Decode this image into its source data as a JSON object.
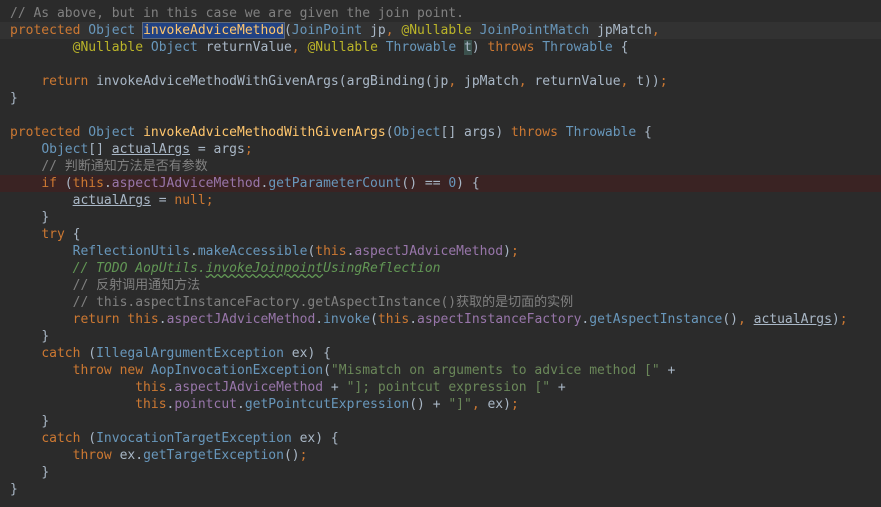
{
  "code_lines": [
    "// As above, but in this case we are given the join point.",
    "protected Object invokeAdviceMethod(JoinPoint jp, @Nullable JoinPointMatch jpMatch,",
    "        @Nullable Object returnValue, @Nullable Throwable t) throws Throwable {",
    "",
    "    return invokeAdviceMethodWithGivenArgs(argBinding(jp, jpMatch, returnValue, t));",
    "}",
    "",
    "protected Object invokeAdviceMethodWithGivenArgs(Object[] args) throws Throwable {",
    "    Object[] actualArgs = args;",
    "    // 判断通知方法是否有参数",
    "    if (this.aspectJAdviceMethod.getParameterCount() == 0) {",
    "        actualArgs = null;",
    "    }",
    "    try {",
    "        ReflectionUtils.makeAccessible(this.aspectJAdviceMethod);",
    "        // TODO AopUtils.invokeJoinpointUsingReflection",
    "        // 反射调用通知方法",
    "        // this.aspectInstanceFactory.getAspectInstance()获取的是切面的实例",
    "        return this.aspectJAdviceMethod.invoke(this.aspectInstanceFactory.getAspectInstance(), actualArgs);",
    "    }",
    "    catch (IllegalArgumentException ex) {",
    "        throw new AopInvocationException(\"Mismatch on arguments to advice method [\" +",
    "                this.aspectJAdviceMethod + \"]; pointcut expression [\" +",
    "                this.pointcut.getPointcutExpression() + \"]\", ex);",
    "    }",
    "    catch (InvocationTargetException ex) {",
    "        throw ex.getTargetException();",
    "    }",
    "}"
  ],
  "colors": {
    "background": "#2b2b2b",
    "comment": "#808080",
    "doc_comment": "#629755",
    "keyword": "#cc7832",
    "type": "#6897bb",
    "method": "#ffc66d",
    "field": "#9876aa",
    "annotation": "#bbb529",
    "string": "#6a8759",
    "plain": "#a9b7c6"
  }
}
